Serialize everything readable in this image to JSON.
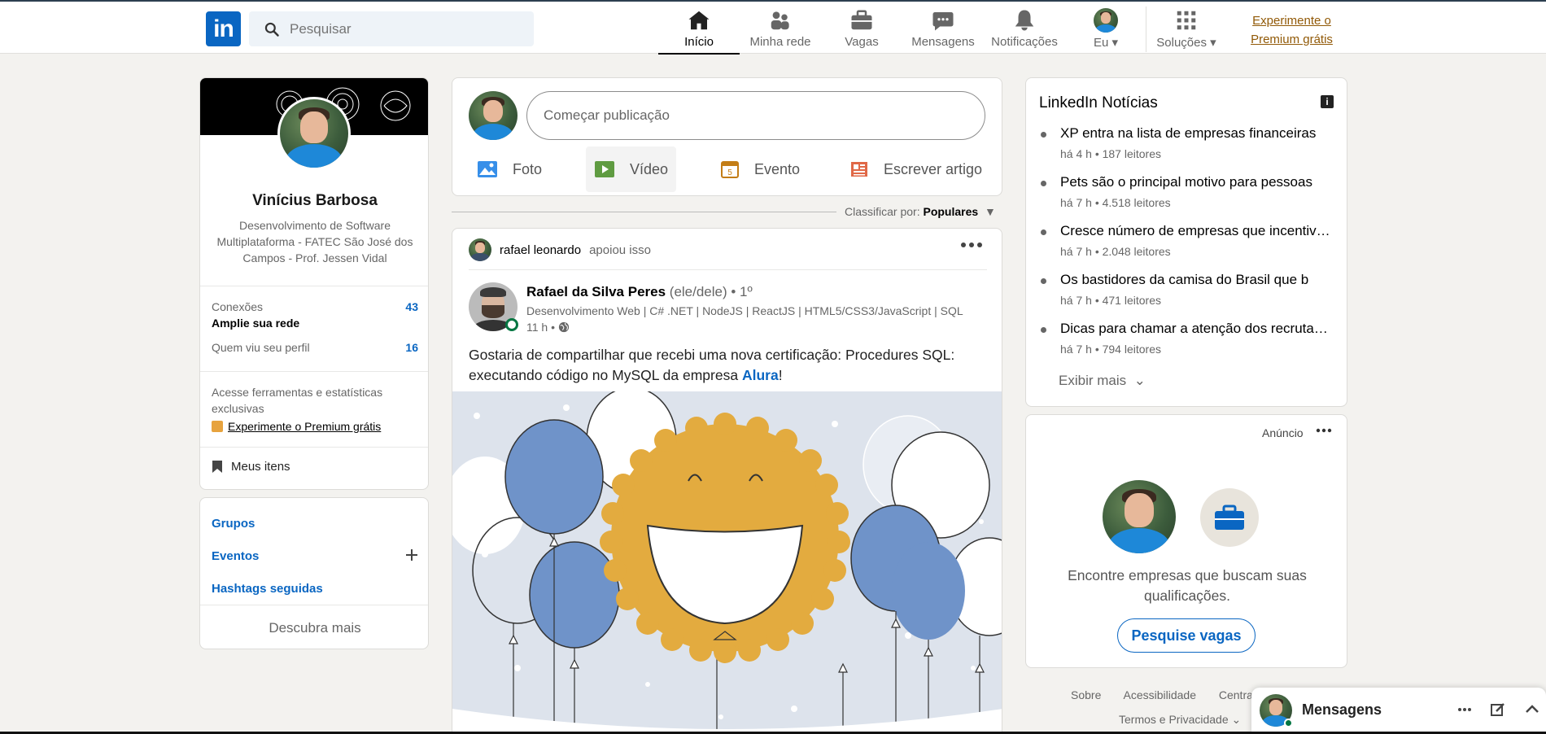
{
  "nav": {
    "search_placeholder": "Pesquisar",
    "items": [
      {
        "label": "Início",
        "icon": "home-icon",
        "active": true
      },
      {
        "label": "Minha rede",
        "icon": "network-icon"
      },
      {
        "label": "Vagas",
        "icon": "briefcase-icon"
      },
      {
        "label": "Mensagens",
        "icon": "messaging-icon"
      },
      {
        "label": "Notificações",
        "icon": "bell-icon"
      }
    ],
    "me_label": "Eu",
    "solutions_label": "Soluções",
    "premium_line1": "Experimente o",
    "premium_line2": "Premium grátis"
  },
  "profile": {
    "name": "Vinícius Barbosa",
    "headline": "Desenvolvimento de Software Multiplataforma - FATEC São José dos Campos - Prof. Jessen Vidal",
    "connections_label": "Conexões",
    "connections_count": "43",
    "grow_network": "Amplie sua rede",
    "profile_viewers_label": "Quem viu seu perfil",
    "profile_viewers_count": "16",
    "premium_text": "Acesse ferramentas e estatísticas exclusivas",
    "premium_link": "Experimente o Premium grátis",
    "my_items": "Meus itens"
  },
  "groups_card": {
    "groups": "Grupos",
    "events": "Eventos",
    "hashtags": "Hashtags seguidas",
    "discover": "Descubra mais"
  },
  "share": {
    "placeholder": "Começar publicação",
    "photo": "Foto",
    "video": "Vídeo",
    "event": "Evento",
    "article": "Escrever artigo"
  },
  "sort": {
    "label": "Classificar por:",
    "value": "Populares"
  },
  "post": {
    "reactor_name": "rafael leonardo",
    "reactor_action": "apoiou isso",
    "author_name": "Rafael da Silva Peres",
    "author_pronouns": "(ele/dele) • 1º",
    "author_headline": "Desenvolvimento Web | C# .NET | NodeJS | ReactJS | HTML5/CSS3/JavaScript | SQL",
    "time": "11 h •",
    "text_before": "Gostaria de compartilhar que recebi uma nova certificação: Procedures SQL: executando código no MySQL da empresa ",
    "text_link": "Alura",
    "text_after": "!"
  },
  "news": {
    "title": "LinkedIn Notícias",
    "items": [
      {
        "headline": "XP entra na lista de empresas financeiras",
        "meta": "há 4 h • 187 leitores"
      },
      {
        "headline": "Pets são o principal motivo para pessoas",
        "meta": "há 7 h • 4.518 leitores"
      },
      {
        "headline": "Cresce número de empresas que incentivam",
        "meta": "há 7 h • 2.048 leitores"
      },
      {
        "headline": "Os bastidores da camisa do Brasil que b",
        "meta": "há 7 h • 471 leitores"
      },
      {
        "headline": "Dicas para chamar a atenção dos recrutadores",
        "meta": "há 7 h • 794 leitores"
      }
    ],
    "more": "Exibir mais"
  },
  "ad": {
    "label": "Anúncio",
    "description": "Encontre empresas que buscam suas qualificações.",
    "button": "Pesquise vagas"
  },
  "footer": {
    "about": "Sobre",
    "accessibility": "Acessibilidade",
    "help": "Central",
    "terms": "Termos e Privacidade"
  },
  "messaging": {
    "label": "Mensagens"
  },
  "colors": {
    "brand": "#0a66c2",
    "background": "#f3f2ef",
    "premium": "#915907"
  }
}
